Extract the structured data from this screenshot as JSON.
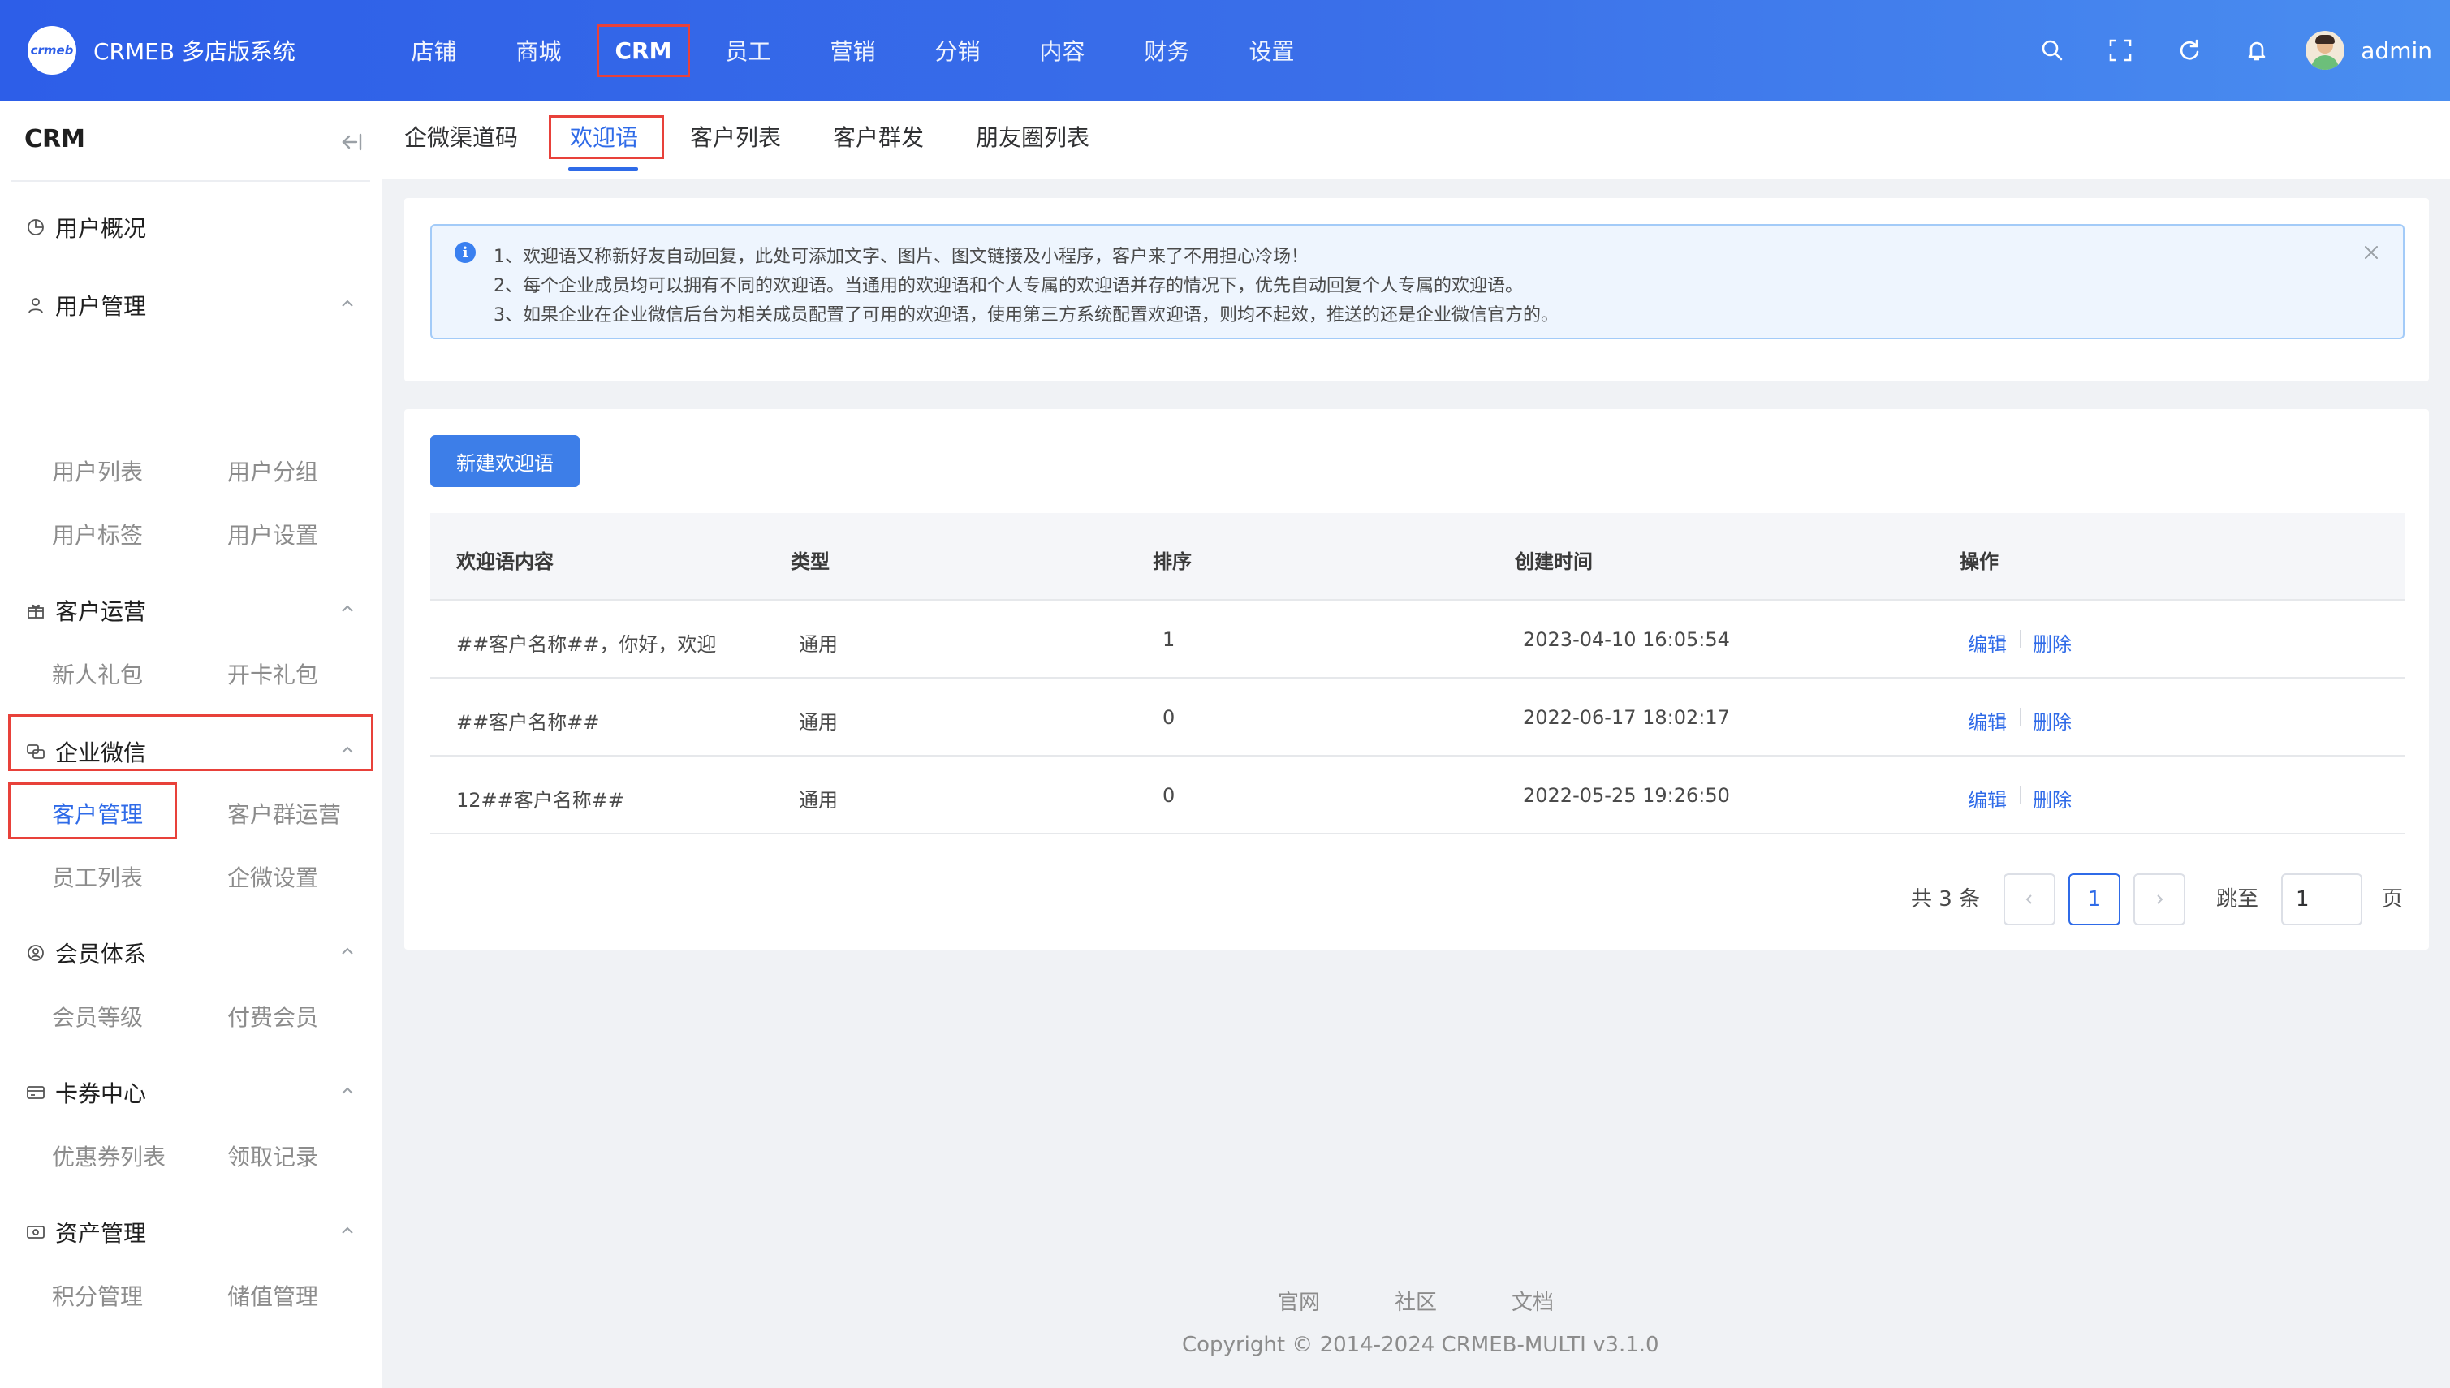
{
  "header": {
    "logo_text": "crmeb",
    "brand": "CRMEB 多店版系统",
    "nav": [
      "店铺",
      "商城",
      "CRM",
      "员工",
      "营销",
      "分销",
      "内容",
      "财务",
      "设置"
    ],
    "active_nav": "CRM",
    "username": "admin",
    "accent_color": "#2d5ee8",
    "tool_icons": [
      "search-icon",
      "fullscreen-icon",
      "refresh-icon",
      "bell-icon"
    ]
  },
  "sidebar": {
    "title": "CRM",
    "overview": "用户概况",
    "groups": [
      {
        "label": "用户管理",
        "icon": "user-icon",
        "items": [
          "用户列表",
          "用户分组",
          "用户标签",
          "用户设置"
        ]
      },
      {
        "label": "客户运营",
        "icon": "gift-icon",
        "items": [
          "新人礼包",
          "开卡礼包"
        ]
      },
      {
        "label": "企业微信",
        "icon": "chat-icon",
        "items": [
          "客户管理",
          "客户群运营",
          "员工列表",
          "企微设置"
        ]
      },
      {
        "label": "会员体系",
        "icon": "member-icon",
        "items": [
          "会员等级",
          "付费会员"
        ]
      },
      {
        "label": "卡券中心",
        "icon": "card-icon",
        "items": [
          "优惠券列表",
          "领取记录"
        ]
      },
      {
        "label": "资产管理",
        "icon": "wallet-icon",
        "items": [
          "积分管理",
          "储值管理"
        ]
      }
    ],
    "active_item": "客户管理"
  },
  "tabs": {
    "items": [
      "企微渠道码",
      "欢迎语",
      "客户列表",
      "客户群发",
      "朋友圈列表"
    ],
    "active": "欢迎语"
  },
  "alert": {
    "lines": [
      "1、欢迎语又称新好友自动回复，此处可添加文字、图片、图文链接及小程序，客户来了不用担心冷场！",
      "2、每个企业成员均可以拥有不同的欢迎语。当通用的欢迎语和个人专属的欢迎语并存的情况下，优先自动回复个人专属的欢迎语。",
      "3、如果企业在企业微信后台为相关成员配置了可用的欢迎语，使用第三方系统配置欢迎语，则均不起效，推送的还是企业微信官方的。"
    ]
  },
  "toolbar": {
    "new_button": "新建欢迎语"
  },
  "table": {
    "columns": [
      "欢迎语内容",
      "类型",
      "排序",
      "创建时间",
      "操作"
    ],
    "rows": [
      {
        "content": "##客户名称##，你好，欢迎",
        "type": "通用",
        "sort": "1",
        "created": "2023-04-10 16:05:54"
      },
      {
        "content": "##客户名称##",
        "type": "通用",
        "sort": "0",
        "created": "2022-06-17 18:02:17"
      },
      {
        "content": "12##客户名称##",
        "type": "通用",
        "sort": "0",
        "created": "2022-05-25 19:26:50"
      }
    ],
    "actions": {
      "edit": "编辑",
      "delete": "删除"
    }
  },
  "pagination": {
    "total": "共 3 条",
    "current": "1",
    "jump_label": "跳至",
    "jump_value": "1",
    "page_suffix": "页"
  },
  "footer": {
    "links": [
      "官网",
      "社区",
      "文档"
    ],
    "copyright": "Copyright © 2014-2024 CRMEB-MULTI v3.1.0"
  }
}
